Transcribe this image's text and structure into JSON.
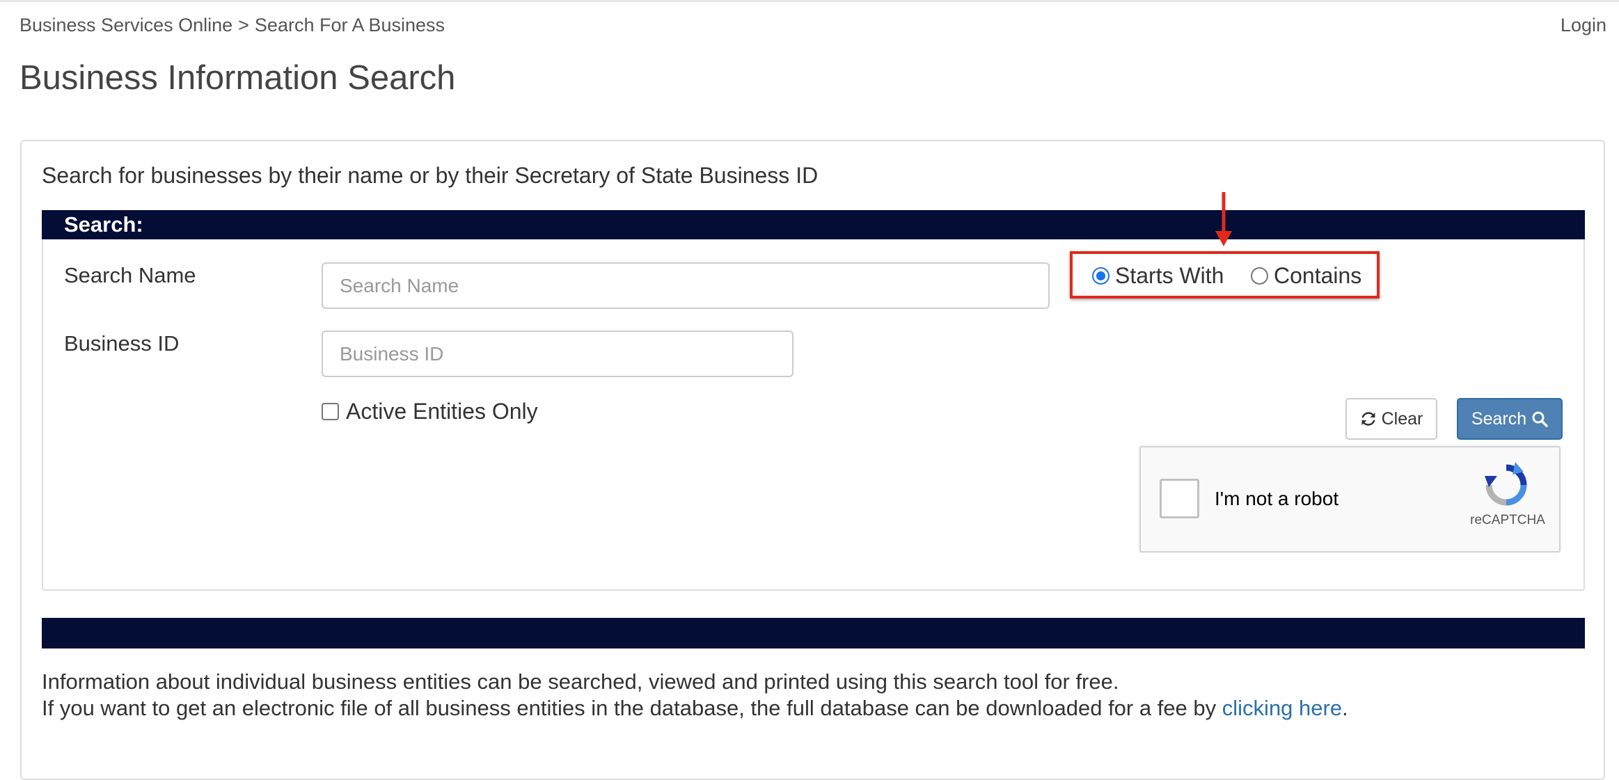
{
  "breadcrumb": {
    "root": "Business Services Online",
    "separator": ">",
    "current": "Search For A Business"
  },
  "header": {
    "login_label": "Login"
  },
  "page": {
    "title": "Business Information Search"
  },
  "intro_text": "Search for businesses by their name or by their Secretary of State Business ID",
  "search_section": {
    "header": "Search:",
    "search_name": {
      "label": "Search Name",
      "placeholder": "Search Name",
      "value": ""
    },
    "business_id": {
      "label": "Business ID",
      "placeholder": "Business ID",
      "value": ""
    },
    "match_options": [
      {
        "label": "Starts With",
        "selected": true
      },
      {
        "label": "Contains",
        "selected": false
      }
    ],
    "active_only": {
      "label": "Active Entities Only",
      "checked": false
    },
    "clear_label": "Clear",
    "search_label": "Search"
  },
  "recaptcha": {
    "label": "I'm not a robot",
    "brand": "reCAPTCHA"
  },
  "info": {
    "line1": "Information about individual business entities can be searched, viewed and printed using this search tool for free.",
    "line2": "If you want to get an electronic file of all business entities in the database, the full database can be downloaded for a fee by",
    "link_text": "clicking here",
    "line2_end": "."
  },
  "colors": {
    "section_header_bg": "#040d35",
    "search_button_bg": "#4f81b4",
    "link": "#2a6fb0",
    "annotation": "#e02a1b",
    "radio_selected": "#1a73e8"
  },
  "icons": {
    "clear": "refresh-icon",
    "search": "magnifier-icon",
    "captcha": "recaptcha-logo-icon"
  }
}
